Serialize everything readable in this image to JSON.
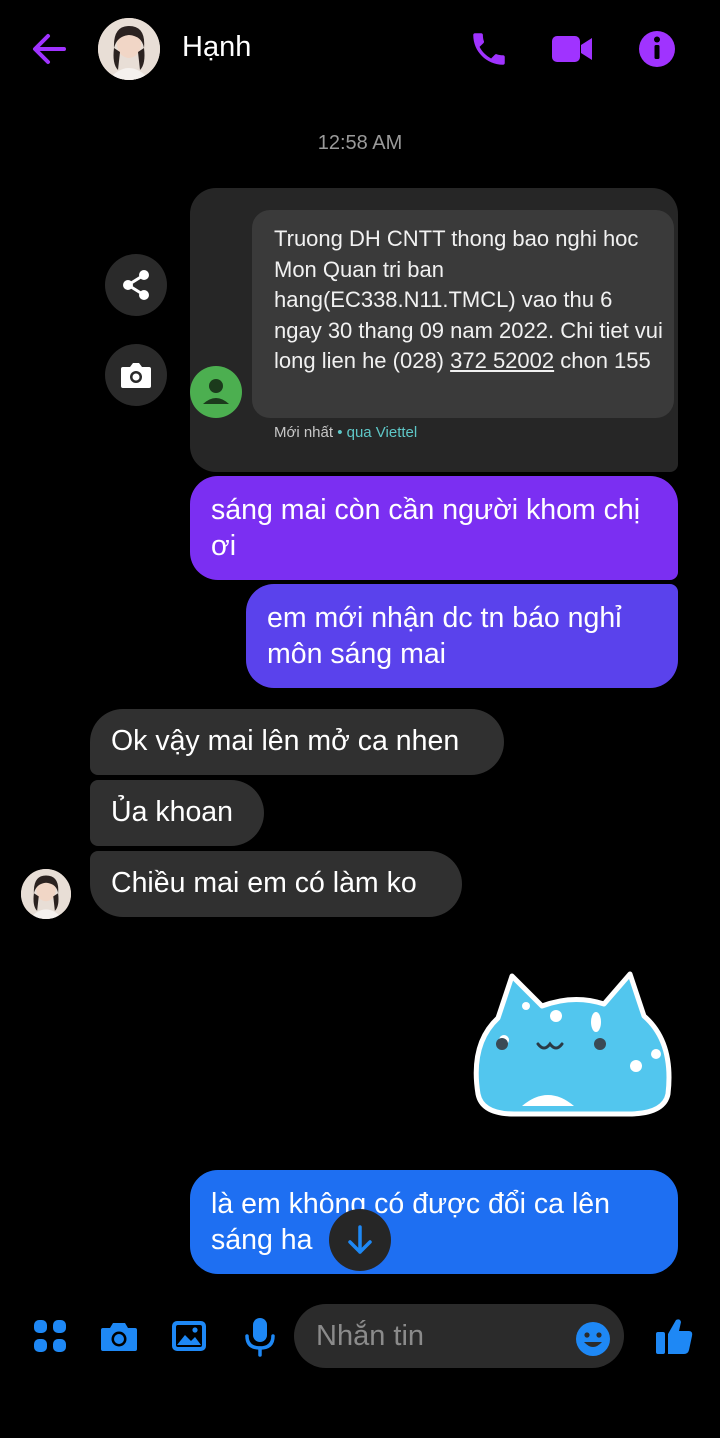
{
  "header": {
    "contact_name": "Hạnh",
    "icons": [
      "back-arrow-icon",
      "phone-icon",
      "video-camera-icon",
      "info-icon"
    ]
  },
  "conversation": {
    "timestamp": "12:58 AM",
    "screenshot_message": {
      "sms_text_before": "Truong DH CNTT thong bao nghi hoc Mon Quan tri ban hang(EC338.N11.TMCL) vao thu 6 ngay 30 thang 09 nam 2022. Chi tiet vui long lien he (028) ",
      "sms_phone": "372 52002",
      "sms_text_after": " chon 155",
      "meta_label": "Mới nhất",
      "meta_via": " • qua Viettel"
    },
    "outgoing": [
      "sáng mai còn cần người khom chị ơi",
      "em mới nhận dc tn báo nghỉ môn sáng mai",
      "là em không có được đổi ca lên sáng ha"
    ],
    "incoming": [
      "Ok vậy mai lên mở ca nhen",
      "Ủa khoan",
      "Chiều mai em có làm ko"
    ]
  },
  "composer": {
    "placeholder": "Nhắn tin"
  },
  "colors": {
    "accent": "#a033ff",
    "out_purple": "#7b2ff2",
    "out_indigo": "#5a42ec",
    "out_blue": "#1e6ff2",
    "incoming": "#303030",
    "composer_icons": "#1e88f5"
  }
}
